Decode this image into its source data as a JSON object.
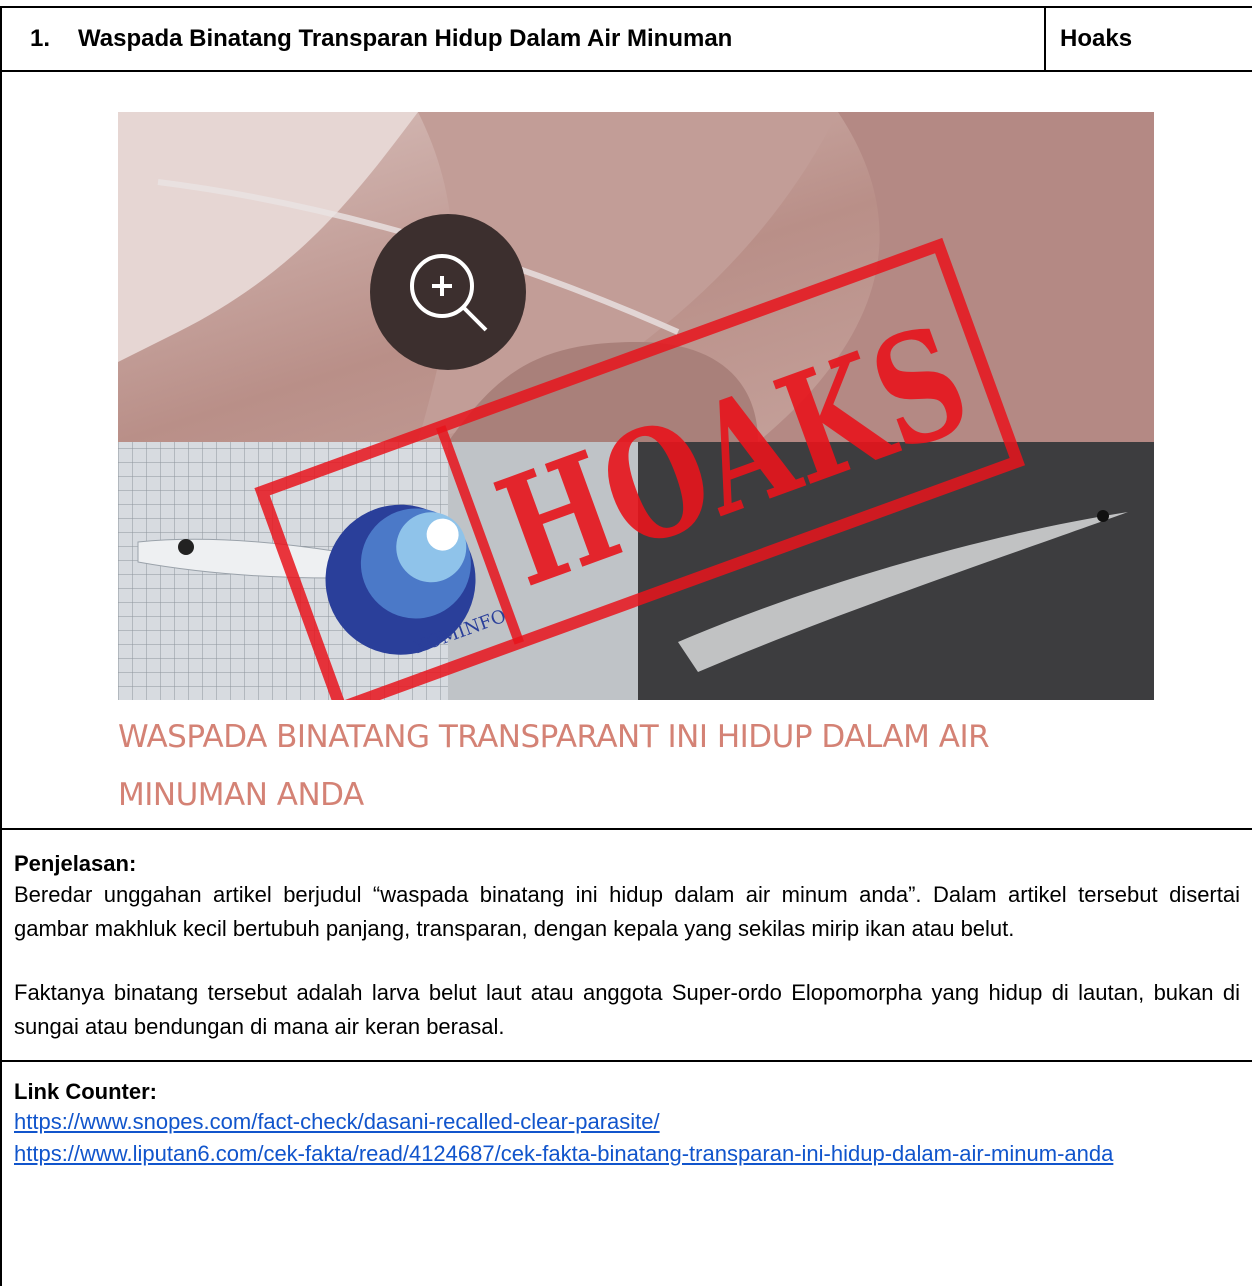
{
  "header": {
    "number": "1.",
    "title": "Waspada Binatang Transparan Hidup Dalam Air Minuman",
    "verdict": "Hoaks"
  },
  "image": {
    "stamp_text": "HOAKS",
    "logo_text": "KOMINFO",
    "caption_line1": "WASPADA BINATANG TRANSPARANT INI HIDUP DALAM AIR",
    "caption_line2": "MINUMAN ANDA",
    "colors": {
      "stamp_red": "#e8141c",
      "logo_blue": "#2a3f9a",
      "skin": "#c49a94"
    }
  },
  "explanation": {
    "title": "Penjelasan:",
    "paragraph1": "Beredar unggahan artikel berjudul “waspada binatang ini hidup dalam air minum anda”. Dalam artikel tersebut disertai gambar makhluk kecil bertubuh panjang, transparan, dengan kepala yang sekilas mirip ikan atau belut.",
    "paragraph2": "Faktanya binatang tersebut adalah larva belut laut atau anggota Super-ordo Elopomorpha yang hidup di lautan, bukan di sungai atau bendungan di mana air keran berasal."
  },
  "links": {
    "title": "Link Counter:",
    "items": [
      "https://www.snopes.com/fact-check/dasani-recalled-clear-parasite/",
      "https://www.liputan6.com/cek-fakta/read/4124687/cek-fakta-binatang-transparan-ini-hidup-dalam-air-minum-anda"
    ]
  }
}
